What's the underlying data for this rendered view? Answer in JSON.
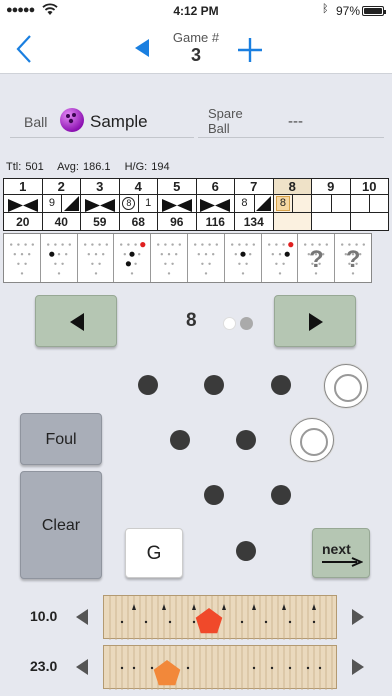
{
  "status": {
    "carrier": "●●●●●",
    "time": "4:12 PM",
    "battery": "97%"
  },
  "nav": {
    "game_label": "Game #",
    "game_number": "3"
  },
  "ball": {
    "label": "Ball",
    "value": "Sample",
    "color": "#b21fd6"
  },
  "spare_ball": {
    "label": "Spare Ball",
    "value": "---"
  },
  "stats": {
    "total": "Ttl: 501",
    "average": "Avg: 186.1",
    "high_game": "H/G: 194"
  },
  "scorecard": {
    "frames": [
      "1",
      "2",
      "3",
      "4",
      "5",
      "6",
      "7",
      "8",
      "9",
      "10"
    ],
    "current_frame": "8",
    "balls": [
      {
        "b1": "",
        "b2": "",
        "strike": true
      },
      {
        "b1": "9",
        "b2": "",
        "spare": true
      },
      {
        "b1": "",
        "b2": "",
        "strike": true
      },
      {
        "b1": "8",
        "b2": "1",
        "split": true
      },
      {
        "b1": "",
        "b2": "",
        "strike": true
      },
      {
        "b1": "",
        "b2": "",
        "strike": true
      },
      {
        "b1": "8",
        "b2": "",
        "spare": true
      },
      {
        "b1": "8",
        "b2": "",
        "selected": true
      },
      {
        "b1": "",
        "b2": ""
      },
      {
        "b1": "",
        "b2": "",
        "b3": ""
      }
    ],
    "totals": [
      "20",
      "40",
      "59",
      "68",
      "96",
      "116",
      "134",
      "",
      "",
      ""
    ]
  },
  "controls": {
    "frame_display": "8",
    "foul_label": "Foul",
    "clear_label": "Clear",
    "gutter_label": "G",
    "next_label": "next"
  },
  "boards": [
    {
      "value": "10.0",
      "marker": 17.5
    },
    {
      "value": "23.0",
      "marker": 10.5
    }
  ],
  "colors": {
    "accent": "#1a7fe0",
    "action_button": "#b5c6b3",
    "neutral_button": "#a9aeb8",
    "marker_red": "#f0492a",
    "marker_orange": "#f2883a"
  }
}
